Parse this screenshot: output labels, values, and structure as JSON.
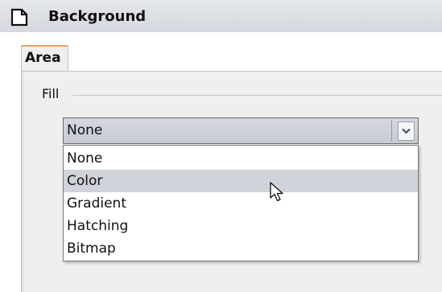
{
  "window": {
    "title": "Background"
  },
  "tabs": [
    {
      "label": "Area",
      "active": true
    }
  ],
  "fill_section": {
    "label": "Fill"
  },
  "fill_select": {
    "selected_value": "None",
    "expanded": true,
    "highlighted_option": "Color",
    "options": [
      "None",
      "Color",
      "Gradient",
      "Hatching",
      "Bitmap"
    ]
  },
  "colors": {
    "titlebar": "#d9dce2",
    "tab_accent": "#f0a15a",
    "highlight": "#d1d3da",
    "panel": "#efefef"
  },
  "icons": {
    "title_icon": "page-icon",
    "dropdown_arrow": "chevron-down-icon",
    "pointer": "arrow-cursor-icon"
  }
}
